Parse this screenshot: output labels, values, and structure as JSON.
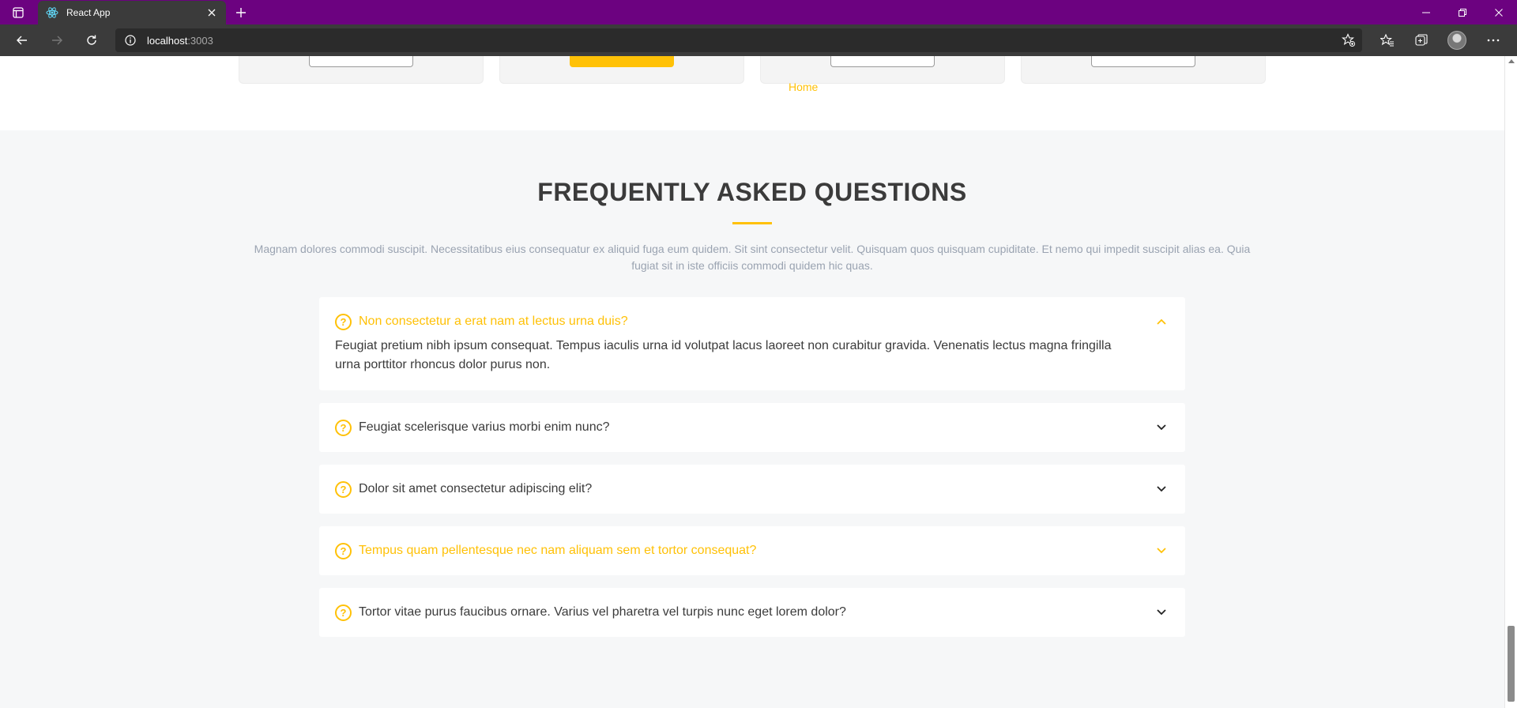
{
  "browser": {
    "tab_title": "React App",
    "url_host": "localhost",
    "url_port": ":3003",
    "titlebar_color": "#6c0280"
  },
  "page": {
    "prev_nav_link": "Home",
    "accent_color": "#ffc107"
  },
  "faq": {
    "title": "FREQUENTLY ASKED QUESTIONS",
    "intro": "Magnam dolores commodi suscipit. Necessitatibus eius consequatur ex aliquid fuga eum quidem. Sit sint consectetur velit. Quisquam quos quisquam cupiditate. Et nemo qui impedit suscipit alias ea. Quia fugiat sit in iste officiis commodi quidem hic quas.",
    "items": [
      {
        "question": "Non consectetur a erat nam at lectus urna duis?",
        "answer": "Feugiat pretium nibh ipsum consequat. Tempus iaculis urna id volutpat lacus laoreet non curabitur gravida. Venenatis lectus magna fringilla urna porttitor rhoncus dolor purus non.",
        "expanded": true
      },
      {
        "question": "Feugiat scelerisque varius morbi enim nunc?",
        "expanded": false
      },
      {
        "question": "Dolor sit amet consectetur adipiscing elit?",
        "expanded": false
      },
      {
        "question": "Tempus quam pellentesque nec nam aliquam sem et tortor consequat?",
        "expanded": false,
        "hovered": true
      },
      {
        "question": "Tortor vitae purus faucibus ornare. Varius vel pharetra vel turpis nunc eget lorem dolor?",
        "expanded": false
      }
    ]
  }
}
